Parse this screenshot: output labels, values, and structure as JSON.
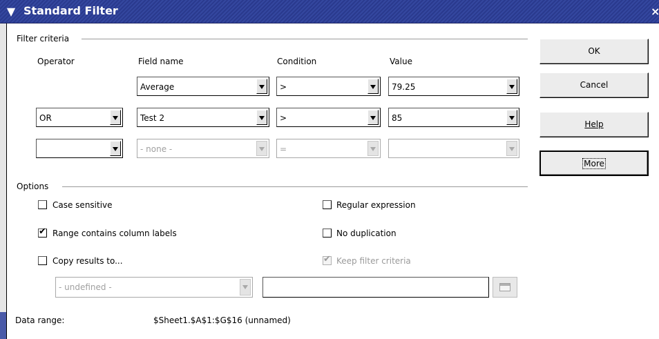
{
  "dialog": {
    "title": "Standard Filter",
    "close_glyph": "×",
    "menu_glyph": "▼"
  },
  "filter_criteria": {
    "section_label": "Filter criteria",
    "headers": {
      "operator": "Operator",
      "field_name": "Field name",
      "condition": "Condition",
      "value": "Value"
    },
    "rows": [
      {
        "operator": "",
        "field": "Average",
        "condition": ">",
        "value": "79.25",
        "operator_visible": false
      },
      {
        "operator": "OR",
        "field": "Test 2",
        "condition": ">",
        "value": "85"
      },
      {
        "operator": "",
        "field": "- none -",
        "condition": "=",
        "value": ""
      }
    ]
  },
  "buttons": {
    "ok": "OK",
    "cancel": "Cancel",
    "help": "Help",
    "more": "More"
  },
  "options": {
    "section_label": "Options",
    "case_sensitive": {
      "label": "Case sensitive",
      "checked": false
    },
    "range_contains_labels": {
      "label": "Range contains column labels",
      "checked": true
    },
    "copy_results": {
      "label": "Copy results to...",
      "checked": false
    },
    "regular_expression": {
      "label": "Regular expression",
      "checked": false
    },
    "no_duplication": {
      "label": "No duplication",
      "checked": false
    },
    "keep_filter_criteria": {
      "label": "Keep filter criteria",
      "checked": true,
      "enabled": false
    },
    "copy_target_combo": "- undefined -",
    "copy_target_field": ""
  },
  "data_range": {
    "label": "Data range:",
    "value": "$Sheet1.$A$1:$G$16 (unnamed)"
  },
  "icons": {
    "menu": "chevron-down-icon",
    "close": "close-icon",
    "shrink": "shrink-dialog-icon",
    "check": "checkmark-icon"
  }
}
